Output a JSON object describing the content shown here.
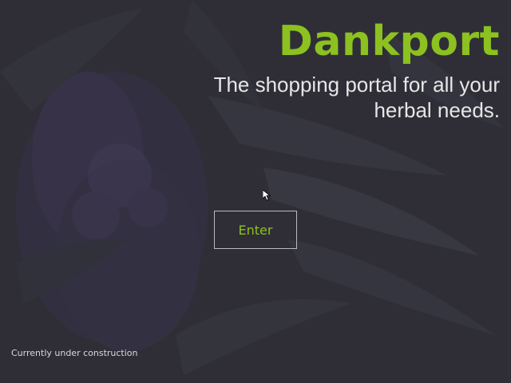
{
  "hero": {
    "title": "Dankport",
    "tagline": "The shopping portal for all your herbal needs."
  },
  "actions": {
    "enter_label": "Enter"
  },
  "footer": {
    "status": "Currently under construction"
  },
  "colors": {
    "accent": "#8cc11f",
    "text": "#e6e6e6",
    "background": "#323236"
  },
  "icons": {
    "cursor": "mouse-pointer-icon"
  }
}
